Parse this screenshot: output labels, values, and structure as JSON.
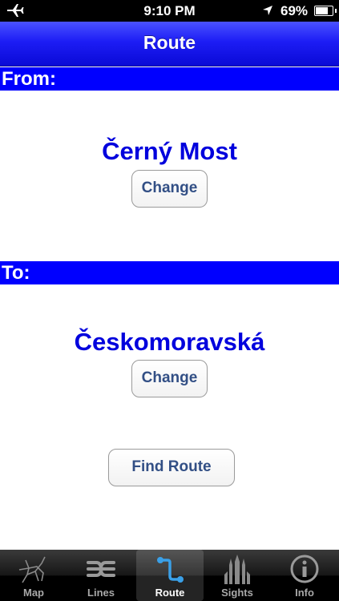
{
  "status_bar": {
    "time": "9:10 PM",
    "battery_percent": "69%",
    "battery_level": 0.69,
    "icons": [
      "airplane-mode-icon",
      "location-arrow-icon",
      "battery-icon"
    ]
  },
  "navbar": {
    "title": "Route"
  },
  "from": {
    "header": "From:",
    "station": "Černý Most",
    "change_label": "Change"
  },
  "to": {
    "header": "To:",
    "station": "Českomoravská",
    "change_label": "Change"
  },
  "find_route_label": "Find Route",
  "tabs": [
    {
      "label": "Map",
      "icon": "map-icon",
      "active": false
    },
    {
      "label": "Lines",
      "icon": "lines-icon",
      "active": false
    },
    {
      "label": "Route",
      "icon": "route-icon",
      "active": true
    },
    {
      "label": "Sights",
      "icon": "sights-icon",
      "active": false
    },
    {
      "label": "Info",
      "icon": "info-icon",
      "active": false
    }
  ],
  "colors": {
    "header_blue": "#0000ff",
    "station_text": "#0000dd",
    "button_text": "#324f85",
    "active_tab_icon": "#3aa0e8"
  }
}
